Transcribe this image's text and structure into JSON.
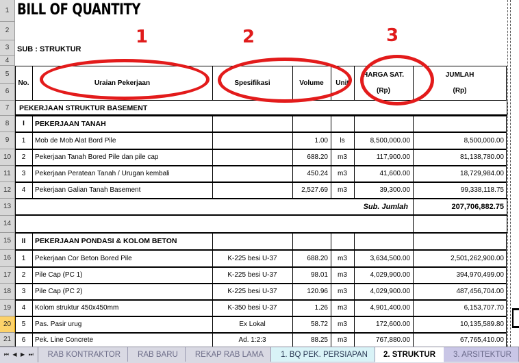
{
  "document": {
    "title": "BILL OF QUANTITY",
    "sub_label": "SUB  : STRUKTUR"
  },
  "annotations": {
    "marks": [
      {
        "label": "1",
        "target": "Uraian Pekerjaan"
      },
      {
        "label": "2",
        "target": "Spesifikasi / Volume / Unit"
      },
      {
        "label": "3",
        "target": "HARGA SAT. (Rp)"
      }
    ],
    "color": "#e31b1b"
  },
  "columns": {
    "no": "No.",
    "uraian": "Uraian Pekerjaan",
    "spesifikasi": "Spesifikasi",
    "volume": "Volume",
    "unit": "Unit",
    "harga_sat_1": "HARGA SAT.",
    "harga_sat_2": "(Rp)",
    "jumlah_1": "JUMLAH",
    "jumlah_2": "(Rp)"
  },
  "row_headers": [
    "1",
    "2",
    "3",
    "4",
    "5",
    "6",
    "7",
    "8",
    "9",
    "10",
    "11",
    "12",
    "13",
    "14",
    "15",
    "16",
    "17",
    "18",
    "19",
    "20",
    "21"
  ],
  "active_row_header": "20",
  "section_title": "PEKERJAAN STRUKTUR BASEMENT",
  "sections": [
    {
      "roman": "I",
      "name": "PEKERJAAN TANAH",
      "rows": [
        {
          "no": "1",
          "uraian": "Mob de Mob Alat Bord Pile",
          "spec": "",
          "volume": "1.00",
          "unit": "ls",
          "harga": "8,500,000.00",
          "jumlah": "8,500,000.00"
        },
        {
          "no": "2",
          "uraian": "Pekerjaan Tanah Bored Pile dan pile cap",
          "spec": "",
          "volume": "688.20",
          "unit": "m3",
          "harga": "117,900.00",
          "jumlah": "81,138,780.00"
        },
        {
          "no": "3",
          "uraian": "Pekerjaan Peratean Tanah / Urugan kembali",
          "spec": "",
          "volume": "450.24",
          "unit": "m3",
          "harga": "41,600.00",
          "jumlah": "18,729,984.00"
        },
        {
          "no": "4",
          "uraian": "Pekerjaan Galian Tanah Basement",
          "spec": "",
          "volume": "2,527.69",
          "unit": "m3",
          "harga": "39,300.00",
          "jumlah": "99,338,118.75"
        }
      ],
      "subtotal_label": "Sub. Jumlah",
      "subtotal_value": "207,706,882.75"
    },
    {
      "roman": "II",
      "name": "PEKERJAAN PONDASI & KOLOM BETON",
      "rows": [
        {
          "no": "1",
          "uraian": "Pekerjaan Cor Beton Bored Pile",
          "spec": "K-225 besi U-37",
          "volume": "688.20",
          "unit": "m3",
          "harga": "3,634,500.00",
          "jumlah": "2,501,262,900.00"
        },
        {
          "no": "2",
          "uraian": "Pile Cap (PC 1)",
          "spec": "K-225 besi U-37",
          "volume": "98.01",
          "unit": "m3",
          "harga": "4,029,900.00",
          "jumlah": "394,970,499.00"
        },
        {
          "no": "3",
          "uraian": "Pile Cap (PC 2)",
          "spec": "K-225 besi U-37",
          "volume": "120.96",
          "unit": "m3",
          "harga": "4,029,900.00",
          "jumlah": "487,456,704.00"
        },
        {
          "no": "4",
          "uraian": "Kolom  struktur 450x450mm",
          "spec": "K-350 besi U-37",
          "volume": "1.26",
          "unit": "m3",
          "harga": "4,901,400.00",
          "jumlah": "6,153,707.70"
        },
        {
          "no": "5",
          "uraian": "Pas. Pasir urug",
          "spec": "Ex Lokal",
          "volume": "58.72",
          "unit": "m3",
          "harga": "172,600.00",
          "jumlah": "10,135,589.80"
        },
        {
          "no": "6",
          "uraian": "Pek. Line Concrete",
          "spec": "Ad. 1:2:3",
          "volume": "88.25",
          "unit": "m3",
          "harga": "767,880.00",
          "jumlah": "67,765,410.00"
        }
      ]
    }
  ],
  "sheet_tabs": {
    "nav": {
      "first": "⏮",
      "prev": "◀",
      "next": "▶",
      "last": "⏭"
    },
    "tabs": [
      {
        "label": "RAB KONTRAKTOR",
        "active": false,
        "tint": "none"
      },
      {
        "label": "RAB BARU",
        "active": false,
        "tint": "none"
      },
      {
        "label": "REKAP RAB LAMA",
        "active": false,
        "tint": "none"
      },
      {
        "label": "1. BQ PEK. PERSIAPAN",
        "active": false,
        "tint": "cyan"
      },
      {
        "label": "2. STRUKTUR",
        "active": true,
        "tint": "none"
      },
      {
        "label": "3. ARSITEKTUR",
        "active": false,
        "tint": "purple"
      }
    ]
  }
}
